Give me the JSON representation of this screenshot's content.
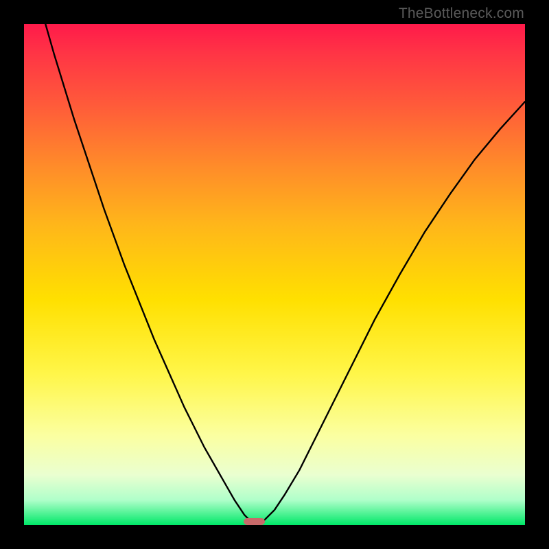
{
  "watermark": "TheBottleneck.com",
  "chart_data": {
    "type": "line",
    "title": "",
    "xlabel": "",
    "ylabel": "",
    "xlim": [
      0,
      100
    ],
    "ylim": [
      0,
      100
    ],
    "series": [
      {
        "name": "bottleneck-curve",
        "x": [
          0,
          2,
          4,
          6,
          8,
          10,
          12,
          14,
          16,
          18,
          20,
          22,
          24,
          26,
          28,
          30,
          32,
          34,
          36,
          38,
          40,
          42,
          43,
          44,
          45,
          46,
          48,
          50,
          52,
          55,
          58,
          62,
          66,
          70,
          75,
          80,
          85,
          90,
          95,
          100
        ],
        "values": [
          116,
          108,
          101,
          94,
          87.5,
          81,
          75,
          69,
          63,
          57.5,
          52,
          47,
          42,
          37,
          32.5,
          28,
          23.5,
          19.5,
          15.5,
          12,
          8.5,
          5,
          3.5,
          2,
          1,
          0,
          1,
          3,
          6,
          11,
          17,
          25,
          33,
          41,
          50,
          58.5,
          66,
          73,
          79,
          84.5
        ]
      }
    ],
    "minimum_marker": {
      "x": 46,
      "width_pct": 4.3,
      "height_pct": 1.4
    },
    "gradient_stops": [
      {
        "pos": 0,
        "color": "#ff1a4a"
      },
      {
        "pos": 55,
        "color": "#ffe000"
      },
      {
        "pos": 100,
        "color": "#00e868"
      }
    ]
  }
}
